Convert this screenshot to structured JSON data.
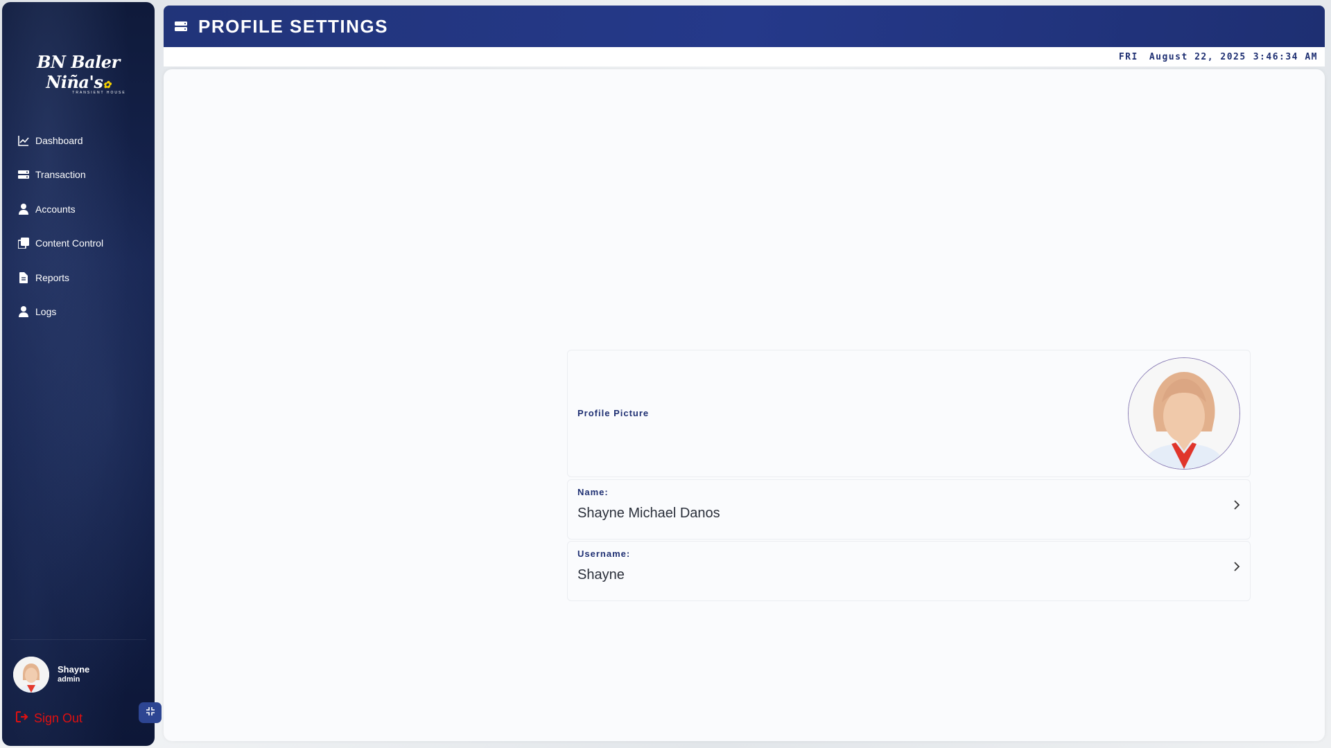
{
  "brand": {
    "name": "BN Baler Niña's",
    "tagline": "TRANSIENT HOUSE"
  },
  "sidebar": {
    "items": [
      {
        "label": "Dashboard",
        "icon": "chart-line-icon"
      },
      {
        "label": "Transaction",
        "icon": "server-icon"
      },
      {
        "label": "Accounts",
        "icon": "user-icon"
      },
      {
        "label": "Content Control",
        "icon": "copy-icon"
      },
      {
        "label": "Reports",
        "icon": "document-icon"
      },
      {
        "label": "Logs",
        "icon": "user-icon"
      }
    ],
    "user": {
      "name": "Shayne",
      "role": "admin"
    },
    "signout_label": "Sign Out"
  },
  "header": {
    "title": "PROFILE SETTINGS"
  },
  "datetime": {
    "day": "FRI",
    "date": "August 22, 2025",
    "time": "3:46:34 AM"
  },
  "profile": {
    "picture_label": "Profile Picture",
    "name_label": "Name:",
    "name_value": "Shayne Michael Danos",
    "username_label": "Username:",
    "username_value": "Shayne"
  },
  "colors": {
    "primary": "#213479",
    "signout": "#e01010",
    "sidebar": "#13204a"
  }
}
